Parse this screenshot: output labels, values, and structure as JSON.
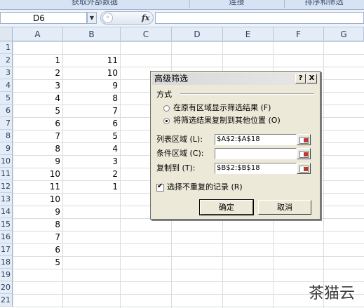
{
  "ribbon": {
    "groups": [
      "获取外部数据",
      "连接",
      "排序和筛选"
    ]
  },
  "formula_bar": {
    "name_box": "D6",
    "fx_label": "fx",
    "formula": ""
  },
  "columns": [
    "A",
    "B",
    "C",
    "D",
    "E",
    "F",
    "G"
  ],
  "rows": [
    "1",
    "2",
    "3",
    "4",
    "5",
    "6",
    "7",
    "8",
    "9",
    "10",
    "11",
    "12",
    "13",
    "14",
    "15",
    "16",
    "17",
    "18",
    "19",
    "20",
    "21"
  ],
  "col_a": [
    "",
    "1",
    "2",
    "3",
    "4",
    "5",
    "6",
    "7",
    "8",
    "9",
    "10",
    "11",
    "10",
    "9",
    "8",
    "7",
    "6",
    "5",
    "",
    "",
    ""
  ],
  "col_b": [
    "",
    "11",
    "10",
    "9",
    "8",
    "7",
    "6",
    "5",
    "4",
    "3",
    "2",
    "1",
    "",
    "",
    "",
    "",
    "",
    "",
    "",
    "",
    ""
  ],
  "dialog": {
    "title": "高级筛选",
    "help_button": "?",
    "close_button": "X",
    "method_label": "方式",
    "radio_in_place": "在原有区域显示筛选结果 (F)",
    "radio_copy": "将筛选结果复制到其他位置 (O)",
    "list_range_label": "列表区域 (L):",
    "list_range_value": "$A$2:$A$18",
    "criteria_range_label": "条件区域 (C):",
    "criteria_range_value": "",
    "copy_to_label": "复制到 (T):",
    "copy_to_value": "$B$2:$B$18",
    "unique_records_label": "选择不重复的记录 (R)",
    "unique_records_checked": true,
    "selected_method": "copy",
    "ok_button": "确定",
    "cancel_button": "取消"
  },
  "watermark": "茶猫云"
}
